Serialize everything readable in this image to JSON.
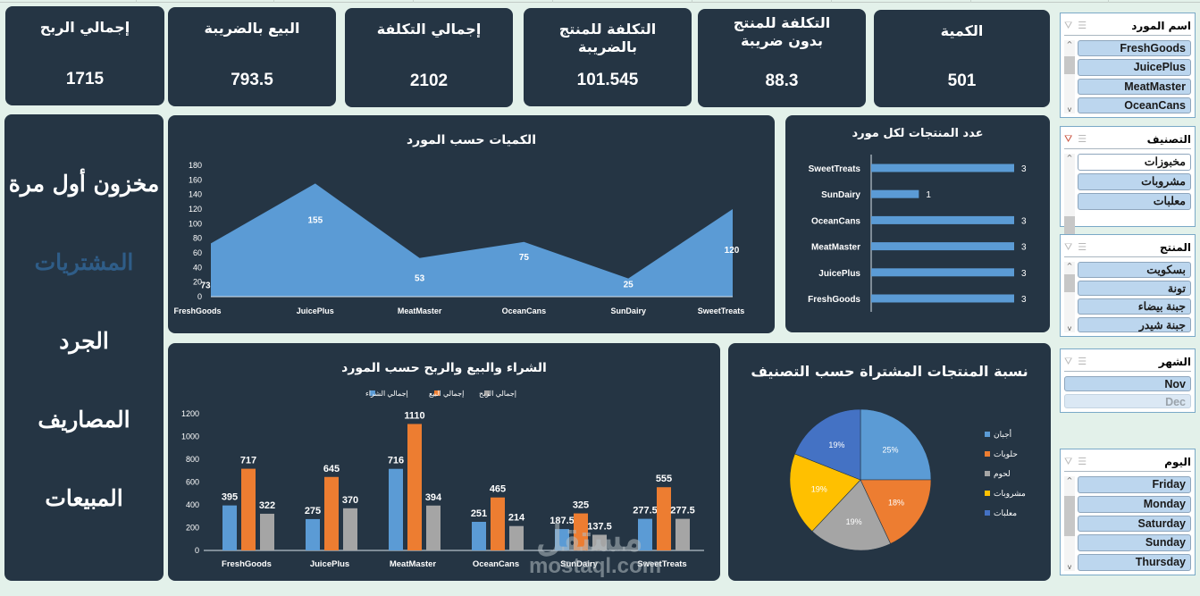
{
  "kpis": [
    {
      "title": "الكمية",
      "value": "501"
    },
    {
      "title": "التكلفة للمنتج\nبدون ضريبة",
      "value": "88.3"
    },
    {
      "title": "التكلفة للمنتج بالضريبة",
      "value": "101.545"
    },
    {
      "title": "إجمالي التكلفة",
      "value": "2102"
    },
    {
      "title": "البيع بالضريبة",
      "value": "793.5"
    },
    {
      "title": "إجمالي الربح",
      "value": "1715"
    }
  ],
  "nav": {
    "items": [
      {
        "label": "مخزون أول مرة",
        "active": false
      },
      {
        "label": "المشتريات",
        "active": true
      },
      {
        "label": "الجرد",
        "active": false
      },
      {
        "label": "المصاريف",
        "active": false
      },
      {
        "label": "المبيعات",
        "active": false
      }
    ]
  },
  "colors": {
    "blue": "#5b9bd5",
    "orange": "#ed7d31",
    "gray": "#a5a5a5",
    "yellow": "#ffc000",
    "darkblue": "#4472c4",
    "card": "#253544",
    "background": "#e3f1ea"
  },
  "chart_data": [
    {
      "id": "qty_by_supplier",
      "type": "area",
      "title": "الكميات حسب المورد",
      "categories": [
        "FreshGoods",
        "JuicePlus",
        "MeatMaster",
        "OceanCans",
        "SunDairy",
        "SweetTreats"
      ],
      "values": [
        73,
        155,
        53,
        75,
        25,
        120
      ],
      "ylim": [
        0,
        180
      ],
      "yticks": [
        0,
        20,
        40,
        60,
        80,
        100,
        120,
        140,
        160,
        180
      ],
      "grid": false
    },
    {
      "id": "products_per_supplier",
      "type": "bar",
      "orientation": "horizontal",
      "title": "عدد المنتجات لكل مورد",
      "categories": [
        "SweetTreats",
        "SunDairy",
        "OceanCans",
        "MeatMaster",
        "JuicePlus",
        "FreshGoods"
      ],
      "values": [
        3,
        1,
        3,
        3,
        3,
        3
      ],
      "xlim": [
        0,
        3
      ]
    },
    {
      "id": "purchase_sales_profit",
      "type": "bar",
      "title": "الشراء والبيع والربح حسب المورد",
      "categories": [
        "FreshGoods",
        "JuicePlus",
        "MeatMaster",
        "OceanCans",
        "SunDairy",
        "SweetTreats"
      ],
      "series": [
        {
          "name": "إجمالي الشراء",
          "color": "#5b9bd5",
          "values": [
            395,
            275,
            716,
            251,
            187.5,
            277.5
          ]
        },
        {
          "name": "إجمالي البيع",
          "color": "#ed7d31",
          "values": [
            717,
            645,
            1110,
            465,
            325,
            555
          ]
        },
        {
          "name": "إجمالي الربح",
          "color": "#a5a5a5",
          "values": [
            322,
            370,
            394,
            214,
            137.5,
            277.5
          ]
        }
      ],
      "ylim": [
        0,
        1200
      ],
      "yticks": [
        0,
        200,
        400,
        600,
        800,
        1000,
        1200
      ],
      "legend": "top"
    },
    {
      "id": "purchased_by_category",
      "type": "pie",
      "title": "نسبة المنتجات المشتراة حسب التصنيف",
      "labels": [
        "أجبان",
        "حلويات",
        "لحوم",
        "مشروبات",
        "معلبات"
      ],
      "values": [
        25,
        18,
        19,
        19,
        19
      ],
      "display_labels": [
        "25%",
        "18%",
        "19%",
        "19%",
        "19%"
      ],
      "colors": [
        "#5b9bd5",
        "#ed7d31",
        "#a5a5a5",
        "#ffc000",
        "#4472c4"
      ],
      "legend": "right"
    }
  ],
  "slicers": [
    {
      "title": "اسم المورد",
      "items": [
        {
          "label": "FreshGoods",
          "state": "selected"
        },
        {
          "label": "JuicePlus",
          "state": "selected"
        },
        {
          "label": "MeatMaster",
          "state": "selected"
        },
        {
          "label": "OceanCans",
          "state": "selected"
        }
      ],
      "scroll": true,
      "filter_active": false
    },
    {
      "title": "التصنيف",
      "items": [
        {
          "label": "مخبوزات",
          "state": "unselected"
        },
        {
          "label": "مشروبات",
          "state": "selected"
        },
        {
          "label": "معلبات",
          "state": "selected"
        }
      ],
      "scroll": true,
      "filter_active": true
    },
    {
      "title": "المنتج",
      "items": [
        {
          "label": "بسكويت",
          "state": "selected"
        },
        {
          "label": "تونة",
          "state": "selected"
        },
        {
          "label": "جبنة بيضاء",
          "state": "selected"
        },
        {
          "label": "جبنة شيدر",
          "state": "selected"
        }
      ],
      "scroll": true,
      "filter_active": false
    },
    {
      "title": "الشهر",
      "items": [
        {
          "label": "Nov",
          "state": "selected"
        },
        {
          "label": "Dec",
          "state": "dim"
        }
      ],
      "scroll": false,
      "filter_active": false
    },
    {
      "title": "اليوم",
      "items": [
        {
          "label": "Friday",
          "state": "selected"
        },
        {
          "label": "Monday",
          "state": "selected"
        },
        {
          "label": "Saturday",
          "state": "selected"
        },
        {
          "label": "Sunday",
          "state": "selected"
        },
        {
          "label": "Thursday",
          "state": "selected"
        }
      ],
      "scroll": true,
      "filter_active": false
    }
  ],
  "slicer_icons": {
    "multi_select": "multi-select-icon",
    "clear_filter": "clear-filter-icon"
  },
  "watermark": {
    "arabic": "مستقل",
    "latin": "mostaql.com"
  }
}
